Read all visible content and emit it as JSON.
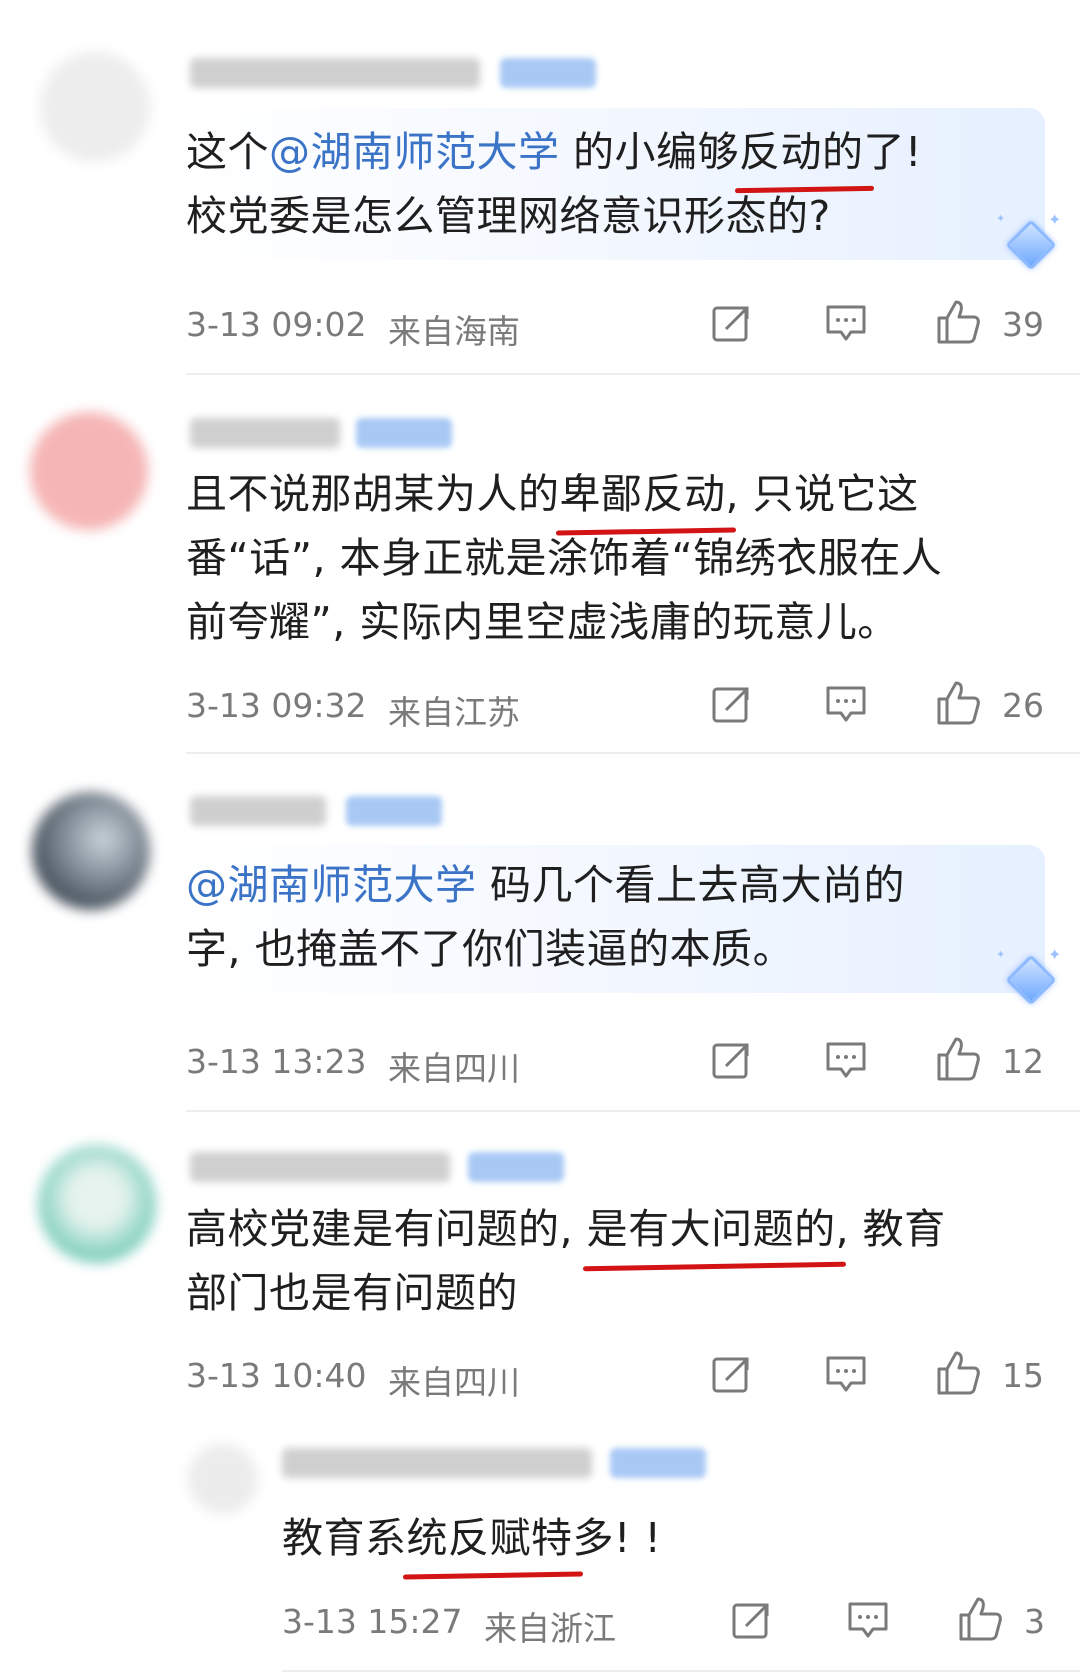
{
  "comments": [
    {
      "text": {
        "line1_part1": "这个",
        "mention": "@湖南师范大学",
        "line1_part2": " 的小编够",
        "line1_underlined": "反动的",
        "line1_part3": "了!",
        "line2": "校党委是怎么管理网络意识形态的?"
      },
      "time": "3-13 09:02",
      "location": "来自海南",
      "likes": "39"
    },
    {
      "text": {
        "line1_part1": "且不说那胡某为人的",
        "line1_underlined": "卑鄙反动",
        "line1_part2": ", 只说它这",
        "line2": "番“话”, 本身正就是涂饰着“锦绣衣服在人",
        "line3": "前夸耀”, 实际内里空虚浅庸的玩意儿。"
      },
      "time": "3-13 09:32",
      "location": "来自江苏",
      "likes": "26"
    },
    {
      "text": {
        "mention": "@湖南师范大学",
        "line1_part1": " 码几个看上去高大尚的",
        "line2": "字, 也掩盖不了你们装逼的本质。"
      },
      "time": "3-13 13:23",
      "location": "来自四川",
      "likes": "12"
    },
    {
      "text": {
        "line1_part1": "高校党建是有问题的, ",
        "line1_underlined": "是有大问题的",
        "line1_part2": ", 教育",
        "line2": "部门也是有问题的"
      },
      "time": "3-13 10:40",
      "location": "来自四川",
      "likes": "15"
    },
    {
      "text": {
        "line1_part1": "教育系",
        "line1_underlined": "统反赋特",
        "line1_part2": "多! !"
      },
      "time": "3-13 15:27",
      "location": "来自浙江",
      "likes": "3"
    }
  ],
  "icons": {
    "share": "share-icon",
    "reply": "comment-icon",
    "like": "thumbs-up-icon"
  },
  "colors": {
    "mention": "#3b74c7",
    "underline": "#d21414",
    "meta": "#7a7a7a",
    "badge": "#a9c9f5"
  }
}
